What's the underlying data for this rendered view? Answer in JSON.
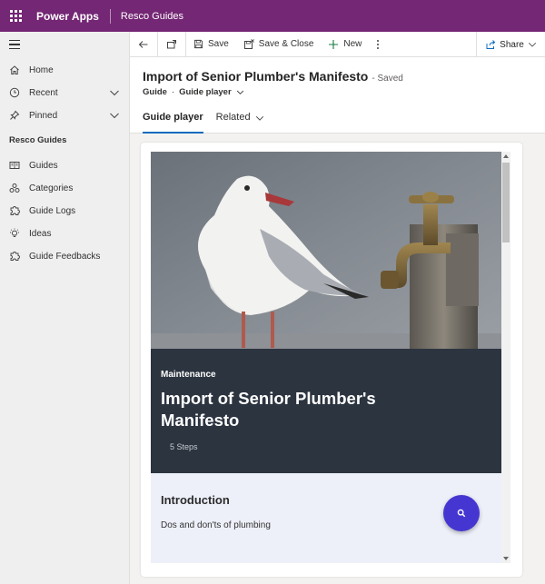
{
  "topbar": {
    "app_name": "Power Apps",
    "environment": "Resco Guides"
  },
  "sidebar": {
    "items": [
      {
        "label": "Home",
        "icon": "home-icon"
      },
      {
        "label": "Recent",
        "icon": "clock-icon"
      },
      {
        "label": "Pinned",
        "icon": "pin-icon"
      }
    ],
    "section_title": "Resco Guides",
    "section_items": [
      {
        "label": "Guides",
        "icon": "guides-icon"
      },
      {
        "label": "Categories",
        "icon": "categories-icon"
      },
      {
        "label": "Guide Logs",
        "icon": "puzzle-icon"
      },
      {
        "label": "Ideas",
        "icon": "lightbulb-icon"
      },
      {
        "label": "Guide Feedbacks",
        "icon": "puzzle-icon"
      }
    ]
  },
  "commandbar": {
    "save": "Save",
    "save_close": "Save & Close",
    "new": "New",
    "share": "Share"
  },
  "record": {
    "title": "Import of Senior Plumber's Manifesto",
    "status": "- Saved",
    "entity": "Guide",
    "form": "Guide player"
  },
  "tabs": [
    {
      "label": "Guide player",
      "active": true
    },
    {
      "label": "Related",
      "active": false
    }
  ],
  "guide": {
    "category": "Maintenance",
    "title": "Import of Senior Plumber's Manifesto",
    "steps": "5 Steps",
    "intro_title": "Introduction",
    "intro_text": "Dos and don'ts of plumbing"
  },
  "colors": {
    "brand": "#742774",
    "accent": "#0f6cbd",
    "banner": "#2c3440",
    "intro_bg": "#edf0f9",
    "fab": "#4636d1"
  }
}
